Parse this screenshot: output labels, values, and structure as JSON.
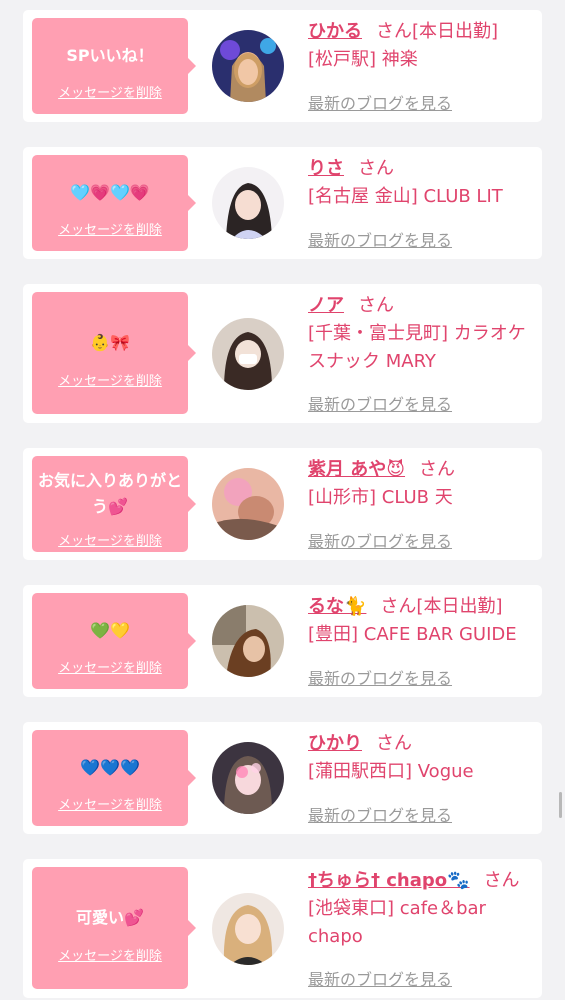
{
  "items": [
    {
      "message": "SPいいね！",
      "delete_label": "メッセージを削除",
      "name": "ひかる",
      "suffix": "さん[本日出勤]",
      "shop": "[松戸駅] 神楽",
      "blog_label": "最新のブログを見る"
    },
    {
      "message": "🩵💗🩵💗",
      "delete_label": "メッセージを削除",
      "name": "りさ",
      "suffix": "さん",
      "shop": "[名古屋 金山] CLUB LIT",
      "blog_label": "最新のブログを見る"
    },
    {
      "message": "👶🎀",
      "delete_label": "メッセージを削除",
      "name": "ノア",
      "suffix": "さん",
      "shop": "[千葉・富士見町] カラオケスナック MARY",
      "blog_label": "最新のブログを見る"
    },
    {
      "message": "お気に入りありがとう💕",
      "delete_label": "メッセージを削除",
      "name": "紫月 あや😈",
      "suffix": "さん",
      "shop": "[山形市] CLUB 天",
      "blog_label": "最新のブログを見る"
    },
    {
      "message": "💚💛",
      "delete_label": "メッセージを削除",
      "name": "るな🐈",
      "suffix": "さん[本日出勤]",
      "shop": "[豊田] CAFE BAR GUIDE",
      "blog_label": "最新のブログを見る"
    },
    {
      "message": "💙💙💙",
      "delete_label": "メッセージを削除",
      "name": "ひかり",
      "suffix": "さん",
      "shop": "[蒲田駅西口] Vogue",
      "blog_label": "最新のブログを見る"
    },
    {
      "message": "可愛い💕",
      "delete_label": "メッセージを削除",
      "name": "†ちゅら† chapo🐾",
      "suffix": "さん",
      "shop": "[池袋東口] cafe＆bar chapo",
      "blog_label": "最新のブログを見る"
    }
  ],
  "colors": {
    "page_bg": "#f2f2f4",
    "bubble": "#ff9fb2",
    "accent": "#e0446d",
    "link_gray": "#9a9a9a"
  }
}
